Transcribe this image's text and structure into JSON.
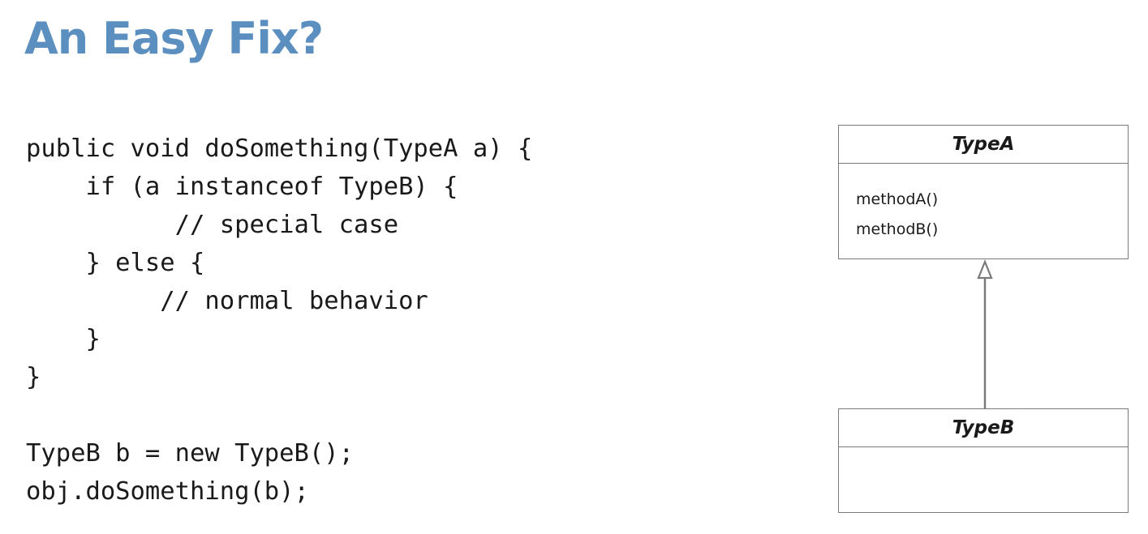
{
  "title": "An Easy Fix?",
  "colors": {
    "title": "#5b8fc0",
    "code_text": "#1a1a1a",
    "uml_border": "#7a7a7a"
  },
  "code": {
    "lines": [
      "public void doSomething(TypeA a) {",
      "    if (a instanceof TypeB) {",
      "          // special case",
      "    } else {",
      "         // normal behavior",
      "    }",
      "}",
      "",
      "TypeB b = new TypeB();",
      "obj.doSomething(b);"
    ]
  },
  "uml": {
    "type_a": {
      "name": "TypeA",
      "methods": [
        "methodA()",
        "methodB()"
      ]
    },
    "type_b": {
      "name": "TypeB",
      "methods": []
    },
    "relationship": "generalization"
  }
}
